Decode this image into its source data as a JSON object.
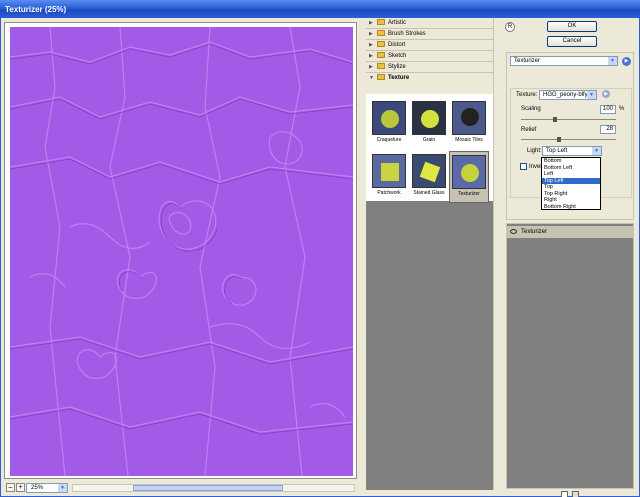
{
  "window": {
    "title": "Texturizer (25%)"
  },
  "statusbar": {
    "zoom": "25%",
    "zoom_out": "–",
    "zoom_in": "+"
  },
  "gallery": {
    "categories": [
      {
        "label": "Artistic",
        "expanded": false
      },
      {
        "label": "Brush Strokes",
        "expanded": false
      },
      {
        "label": "Distort",
        "expanded": false
      },
      {
        "label": "Sketch",
        "expanded": false
      },
      {
        "label": "Stylize",
        "expanded": false
      },
      {
        "label": "Texture",
        "expanded": true
      }
    ],
    "texture_filters": [
      "Craquelure",
      "Grain",
      "Mosaic Tiles",
      "Patchwork",
      "Stained Glass",
      "Texturizer"
    ],
    "selected_filter": "Texturizer"
  },
  "buttons": {
    "ok": "OK",
    "cancel": "Cancel",
    "help": "R"
  },
  "settings": {
    "filter_select": "Texturizer",
    "texture_label": "Texture:",
    "texture_value": "HGG_peony-blfy",
    "scaling_label": "Scaling",
    "scaling_value": "100",
    "scaling_unit": "%",
    "relief_label": "Relief",
    "relief_value": "28",
    "light_label": "Light:",
    "light_value": "Top Left",
    "invert_label": "Invert",
    "invert_checked": false
  },
  "light_options": [
    "Bottom",
    "Bottom Left",
    "Left",
    "Top Left",
    "Top",
    "Top Right",
    "Right",
    "Bottom Right"
  ],
  "light_selected_index": 3,
  "layers": {
    "items": [
      "Texturizer"
    ]
  },
  "colors": {
    "preview_bg": "#a35ae6",
    "title_bar": "#2a5fd8",
    "selection": "#316ac5"
  },
  "icons": {
    "expand": "triangle-right",
    "collapse": "triangle-down",
    "dropdown": "chevron-down",
    "options": "triangle-right",
    "eye": "eye",
    "new_layer": "new-layer",
    "delete_layer": "trash"
  }
}
